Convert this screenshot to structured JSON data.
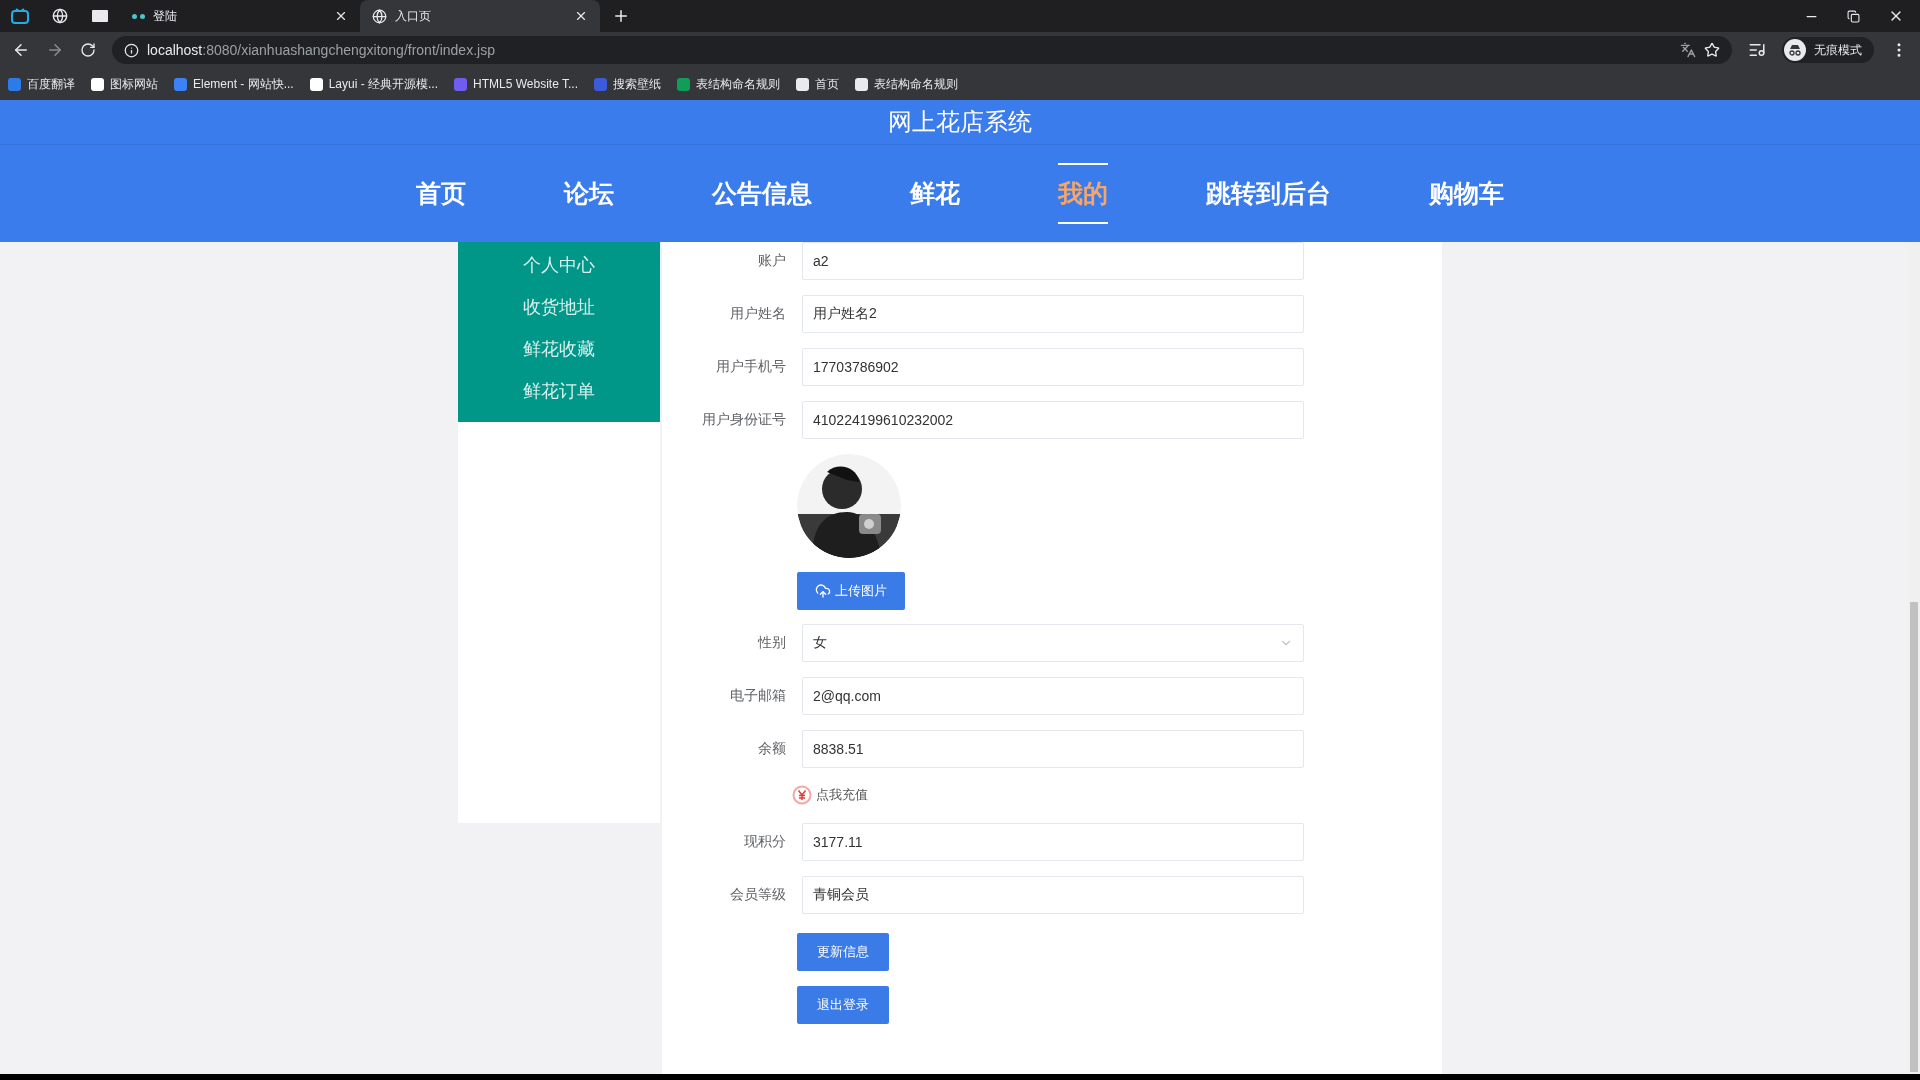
{
  "browser": {
    "tabs": [
      {
        "kind": "pinned",
        "selected": false
      },
      {
        "kind": "pinned",
        "selected": false
      },
      {
        "kind": "pinned",
        "selected": false
      },
      {
        "kind": "normal",
        "title": "登陆",
        "selected": false
      },
      {
        "kind": "normal",
        "title": "入口页",
        "selected": true
      }
    ],
    "url_host": "localhost",
    "url_rest": ":8080/xianhuashangchengxitong/front/index.jsp",
    "profile_label": "无痕模式",
    "bookmarks": [
      "百度翻译",
      "图标网站",
      "Element - 网站快...",
      "Layui - 经典开源模...",
      "HTML5 Website T...",
      "搜索壁纸",
      "表结构命名规则",
      "首页",
      "表结构命名规则"
    ]
  },
  "header": {
    "title": "网上花店系统"
  },
  "nav": [
    {
      "label": "首页",
      "selected": false
    },
    {
      "label": "论坛",
      "selected": false
    },
    {
      "label": "公告信息",
      "selected": false
    },
    {
      "label": "鲜花",
      "selected": false
    },
    {
      "label": "我的",
      "selected": true
    },
    {
      "label": "跳转到后台",
      "selected": false
    },
    {
      "label": "购物车",
      "selected": false
    }
  ],
  "sidebar": [
    {
      "label": "个人中心"
    },
    {
      "label": "收货地址"
    },
    {
      "label": "鲜花收藏"
    },
    {
      "label": "鲜花订单"
    }
  ],
  "form": [
    {
      "kind": "field",
      "label": "账户",
      "value": "a2"
    },
    {
      "kind": "field",
      "label": "用户姓名",
      "value": "用户姓名2"
    },
    {
      "kind": "field",
      "label": "用户手机号",
      "value": "17703786902"
    },
    {
      "kind": "field",
      "label": "用户身份证号",
      "value": "410224199610232002"
    },
    {
      "kind": "avatar"
    },
    {
      "kind": "upload",
      "label": "上传图片"
    },
    {
      "kind": "select",
      "label": "性别",
      "value": "女"
    },
    {
      "kind": "field",
      "label": "电子邮箱",
      "value": "2@qq.com"
    },
    {
      "kind": "field",
      "label": "余额",
      "value": "8838.51"
    },
    {
      "kind": "recharge",
      "label": "点我充值"
    },
    {
      "kind": "field",
      "label": "现积分",
      "value": "3177.11"
    },
    {
      "kind": "field",
      "label": "会员等级",
      "value": "青铜会员"
    }
  ],
  "buttons": [
    "更新信息",
    "退出登录"
  ]
}
